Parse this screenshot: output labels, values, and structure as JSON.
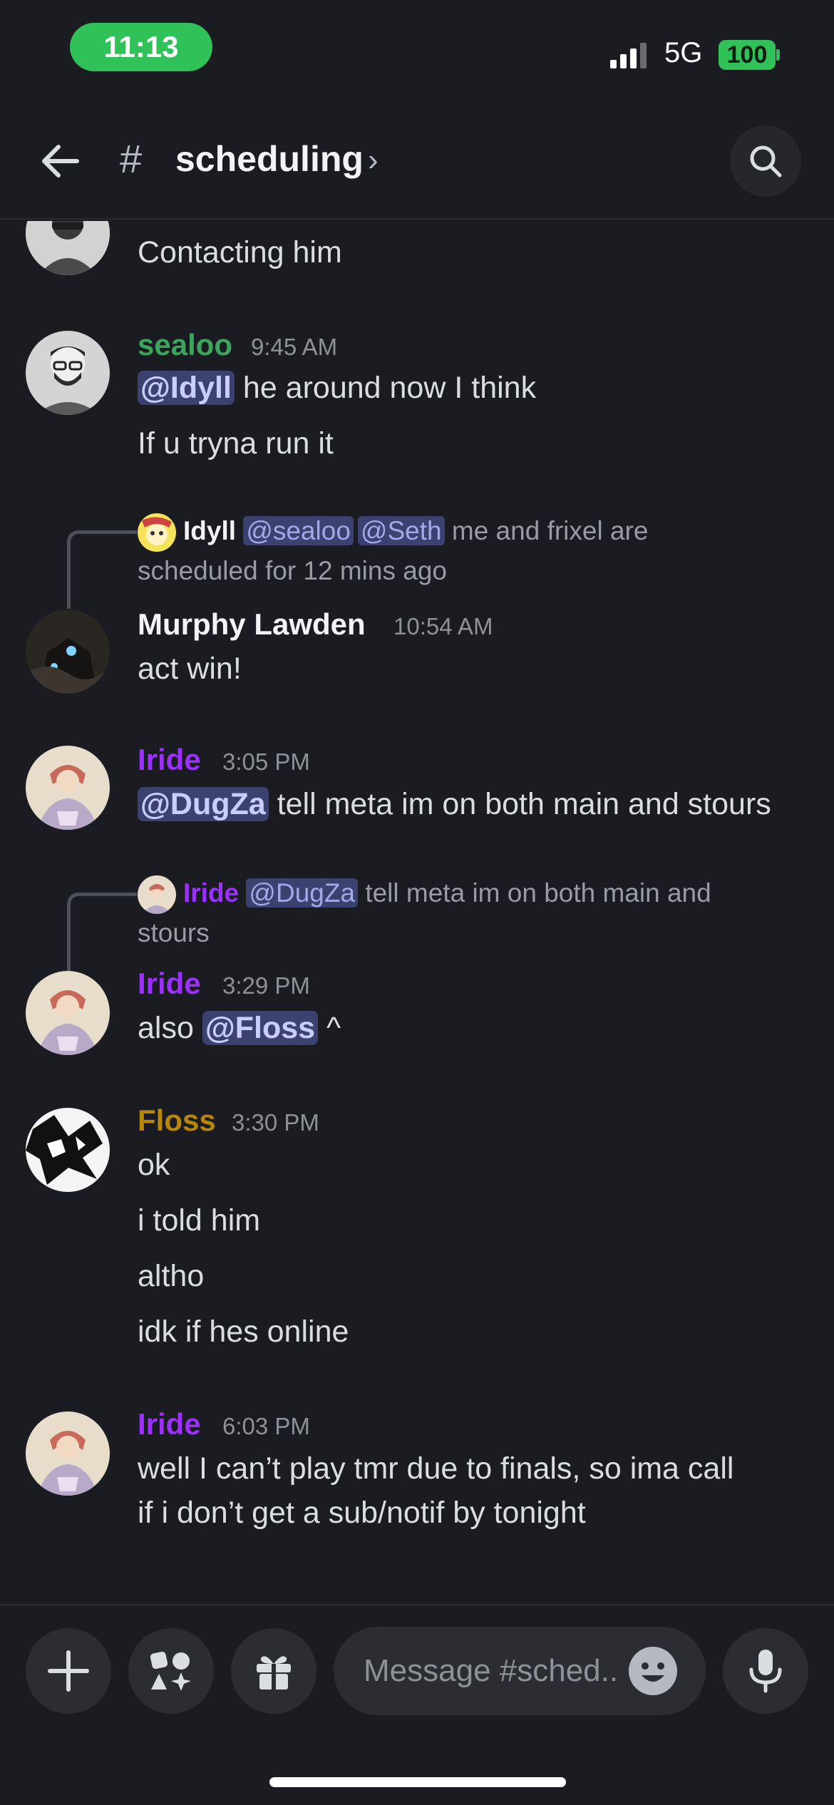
{
  "status_bar": {
    "time": "11:13",
    "network": "5G",
    "battery": "100"
  },
  "header": {
    "channel": "scheduling"
  },
  "messages": [
    {
      "lines": [
        "Contacting him"
      ]
    },
    {
      "author": "sealoo",
      "author_color": "#3ba55c",
      "time": "9:45 AM",
      "mention": "@Idyll",
      "lines": [
        "he around now I think",
        "If u tryna run it"
      ]
    },
    {
      "reply": {
        "author": "Idyll",
        "mentions": [
          "@sealoo",
          "@Seth"
        ],
        "text_1": "me and frixel are",
        "text_2": "scheduled for 12 mins ago"
      },
      "author": "Murphy Lawden",
      "author_color": "#f2f3f5",
      "time": "10:54 AM",
      "lines": [
        "act win!"
      ]
    },
    {
      "author": "Iride",
      "author_color": "#9b30ff",
      "time": "3:05 PM",
      "mention": "@DugZa",
      "lines": [
        "tell meta im on both main and stours"
      ]
    },
    {
      "reply": {
        "author": "Iride",
        "mentions": [
          "@DugZa"
        ],
        "text_1": "tell meta im on both main and",
        "text_2": "stours"
      },
      "author": "Iride",
      "author_color": "#9b30ff",
      "time": "3:29 PM",
      "prefix": "also",
      "mention": "@Floss",
      "suffix": "^"
    },
    {
      "author": "Floss",
      "author_color": "#b8860b",
      "time": "3:30 PM",
      "lines": [
        "ok",
        "i told him",
        "altho",
        "idk if hes online"
      ]
    },
    {
      "author": "Iride",
      "author_color": "#9b30ff",
      "time": "6:03 PM",
      "lines": [
        "well I can’t play tmr due to finals,  so ima call",
        "if i don’t get a sub/notif by tonight"
      ]
    }
  ],
  "composer": {
    "placeholder": "Message #sched.."
  },
  "colors": {
    "accent_green": "#30c158",
    "mention_bg": "#3c4270",
    "background": "#1b1c21"
  }
}
